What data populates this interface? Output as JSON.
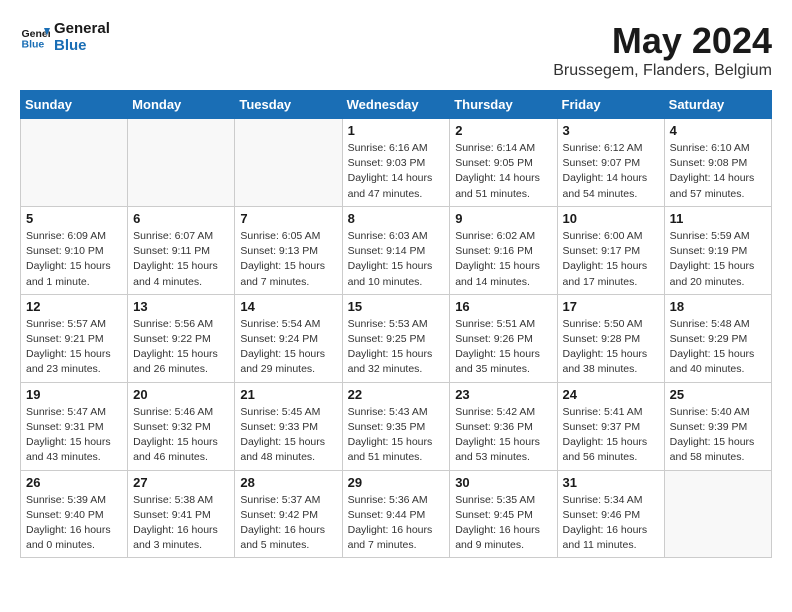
{
  "logo": {
    "line1": "General",
    "line2": "Blue"
  },
  "title": "May 2024",
  "location": "Brussegem, Flanders, Belgium",
  "weekdays": [
    "Sunday",
    "Monday",
    "Tuesday",
    "Wednesday",
    "Thursday",
    "Friday",
    "Saturday"
  ],
  "weeks": [
    [
      {
        "day": "",
        "info": ""
      },
      {
        "day": "",
        "info": ""
      },
      {
        "day": "",
        "info": ""
      },
      {
        "day": "1",
        "info": "Sunrise: 6:16 AM\nSunset: 9:03 PM\nDaylight: 14 hours\nand 47 minutes."
      },
      {
        "day": "2",
        "info": "Sunrise: 6:14 AM\nSunset: 9:05 PM\nDaylight: 14 hours\nand 51 minutes."
      },
      {
        "day": "3",
        "info": "Sunrise: 6:12 AM\nSunset: 9:07 PM\nDaylight: 14 hours\nand 54 minutes."
      },
      {
        "day": "4",
        "info": "Sunrise: 6:10 AM\nSunset: 9:08 PM\nDaylight: 14 hours\nand 57 minutes."
      }
    ],
    [
      {
        "day": "5",
        "info": "Sunrise: 6:09 AM\nSunset: 9:10 PM\nDaylight: 15 hours\nand 1 minute."
      },
      {
        "day": "6",
        "info": "Sunrise: 6:07 AM\nSunset: 9:11 PM\nDaylight: 15 hours\nand 4 minutes."
      },
      {
        "day": "7",
        "info": "Sunrise: 6:05 AM\nSunset: 9:13 PM\nDaylight: 15 hours\nand 7 minutes."
      },
      {
        "day": "8",
        "info": "Sunrise: 6:03 AM\nSunset: 9:14 PM\nDaylight: 15 hours\nand 10 minutes."
      },
      {
        "day": "9",
        "info": "Sunrise: 6:02 AM\nSunset: 9:16 PM\nDaylight: 15 hours\nand 14 minutes."
      },
      {
        "day": "10",
        "info": "Sunrise: 6:00 AM\nSunset: 9:17 PM\nDaylight: 15 hours\nand 17 minutes."
      },
      {
        "day": "11",
        "info": "Sunrise: 5:59 AM\nSunset: 9:19 PM\nDaylight: 15 hours\nand 20 minutes."
      }
    ],
    [
      {
        "day": "12",
        "info": "Sunrise: 5:57 AM\nSunset: 9:21 PM\nDaylight: 15 hours\nand 23 minutes."
      },
      {
        "day": "13",
        "info": "Sunrise: 5:56 AM\nSunset: 9:22 PM\nDaylight: 15 hours\nand 26 minutes."
      },
      {
        "day": "14",
        "info": "Sunrise: 5:54 AM\nSunset: 9:24 PM\nDaylight: 15 hours\nand 29 minutes."
      },
      {
        "day": "15",
        "info": "Sunrise: 5:53 AM\nSunset: 9:25 PM\nDaylight: 15 hours\nand 32 minutes."
      },
      {
        "day": "16",
        "info": "Sunrise: 5:51 AM\nSunset: 9:26 PM\nDaylight: 15 hours\nand 35 minutes."
      },
      {
        "day": "17",
        "info": "Sunrise: 5:50 AM\nSunset: 9:28 PM\nDaylight: 15 hours\nand 38 minutes."
      },
      {
        "day": "18",
        "info": "Sunrise: 5:48 AM\nSunset: 9:29 PM\nDaylight: 15 hours\nand 40 minutes."
      }
    ],
    [
      {
        "day": "19",
        "info": "Sunrise: 5:47 AM\nSunset: 9:31 PM\nDaylight: 15 hours\nand 43 minutes."
      },
      {
        "day": "20",
        "info": "Sunrise: 5:46 AM\nSunset: 9:32 PM\nDaylight: 15 hours\nand 46 minutes."
      },
      {
        "day": "21",
        "info": "Sunrise: 5:45 AM\nSunset: 9:33 PM\nDaylight: 15 hours\nand 48 minutes."
      },
      {
        "day": "22",
        "info": "Sunrise: 5:43 AM\nSunset: 9:35 PM\nDaylight: 15 hours\nand 51 minutes."
      },
      {
        "day": "23",
        "info": "Sunrise: 5:42 AM\nSunset: 9:36 PM\nDaylight: 15 hours\nand 53 minutes."
      },
      {
        "day": "24",
        "info": "Sunrise: 5:41 AM\nSunset: 9:37 PM\nDaylight: 15 hours\nand 56 minutes."
      },
      {
        "day": "25",
        "info": "Sunrise: 5:40 AM\nSunset: 9:39 PM\nDaylight: 15 hours\nand 58 minutes."
      }
    ],
    [
      {
        "day": "26",
        "info": "Sunrise: 5:39 AM\nSunset: 9:40 PM\nDaylight: 16 hours\nand 0 minutes."
      },
      {
        "day": "27",
        "info": "Sunrise: 5:38 AM\nSunset: 9:41 PM\nDaylight: 16 hours\nand 3 minutes."
      },
      {
        "day": "28",
        "info": "Sunrise: 5:37 AM\nSunset: 9:42 PM\nDaylight: 16 hours\nand 5 minutes."
      },
      {
        "day": "29",
        "info": "Sunrise: 5:36 AM\nSunset: 9:44 PM\nDaylight: 16 hours\nand 7 minutes."
      },
      {
        "day": "30",
        "info": "Sunrise: 5:35 AM\nSunset: 9:45 PM\nDaylight: 16 hours\nand 9 minutes."
      },
      {
        "day": "31",
        "info": "Sunrise: 5:34 AM\nSunset: 9:46 PM\nDaylight: 16 hours\nand 11 minutes."
      },
      {
        "day": "",
        "info": ""
      }
    ]
  ]
}
